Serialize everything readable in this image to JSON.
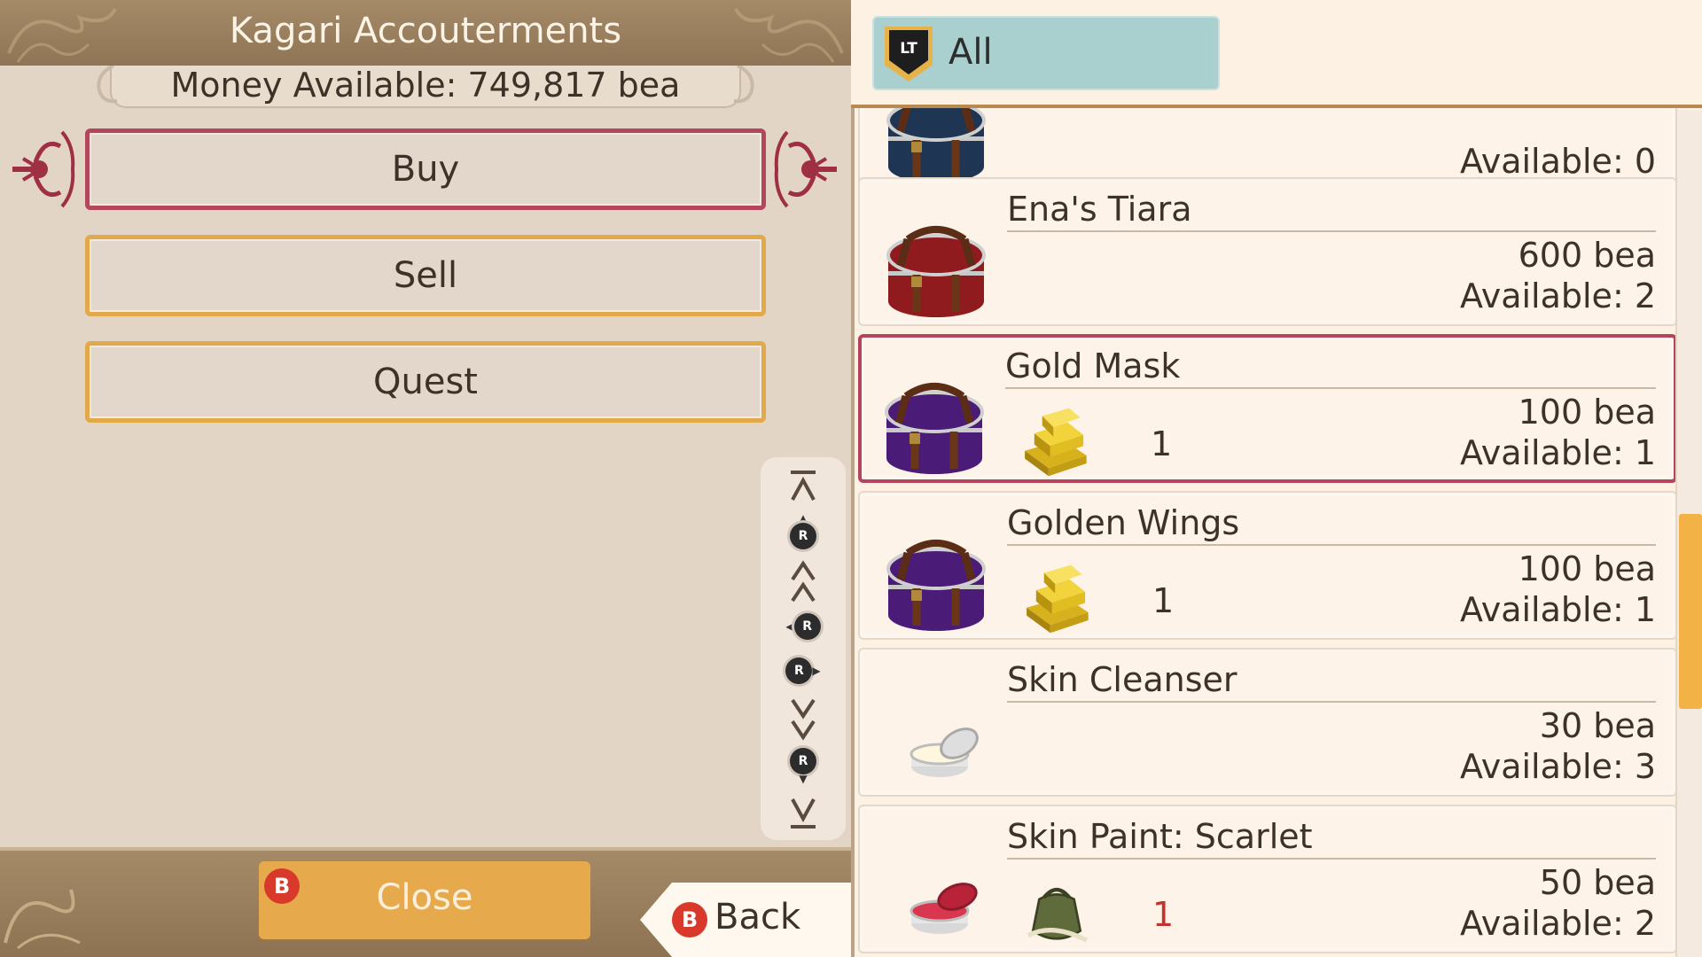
{
  "shop": {
    "title": "Kagari Accouterments",
    "money": "Money Available: 749,817 bea"
  },
  "menu": {
    "buy_label": "Buy",
    "sell_label": "Sell",
    "quest_label": "Quest",
    "selected": "Buy"
  },
  "scroll_controls": {
    "stick_label": "R",
    "items": [
      "scroll-top",
      "page-up-r",
      "scroll-up",
      "scroll-left-r",
      "scroll-right-r",
      "scroll-down",
      "page-down-r",
      "scroll-bottom"
    ]
  },
  "footer": {
    "close_label": "Close",
    "close_button_glyph": "B",
    "back_label": "Back",
    "back_button_glyph": "B"
  },
  "filter": {
    "trigger_glyph": "LT",
    "label": "All"
  },
  "items": [
    {
      "name": "",
      "price": "",
      "available": "Available: 0",
      "icon": "blue-hatbox-icon",
      "material_icon": "",
      "material_qty": "",
      "selected": false
    },
    {
      "name": "Ena's Tiara",
      "price": "600 bea",
      "available": "Available: 2",
      "icon": "red-hatbox-icon",
      "material_icon": "",
      "material_qty": "",
      "selected": false
    },
    {
      "name": "Gold Mask",
      "price": "100 bea",
      "available": "Available: 1",
      "icon": "purple-hatbox-icon",
      "material_icon": "gold-bar-icon",
      "material_qty": "1",
      "selected": true
    },
    {
      "name": "Golden Wings",
      "price": "100 bea",
      "available": "Available: 1",
      "icon": "purple-hatbox-icon",
      "material_icon": "gold-bar-icon",
      "material_qty": "1",
      "selected": false
    },
    {
      "name": "Skin Cleanser",
      "price": "30 bea",
      "available": "Available: 3",
      "icon": "cream-tin-icon",
      "material_icon": "",
      "material_qty": "",
      "selected": false
    },
    {
      "name": "Skin Paint: Scarlet",
      "price": "50 bea",
      "available": "Available: 2",
      "icon": "scarlet-tin-icon",
      "material_icon": "pouch-icon",
      "material_qty": "1",
      "material_insufficient": true,
      "selected": false
    }
  ],
  "list_scroll": {
    "position_fraction": 0.62,
    "visible_fraction": 0.23
  },
  "colors": {
    "title_bar": "#a58a68",
    "button_border": "#e2a94a",
    "selected_border": "#b3455c",
    "filter_tab": "#a9cfcf",
    "close_button": "#e6a94b",
    "b_button": "#d9392b",
    "insufficient_qty": "#c2322f"
  }
}
